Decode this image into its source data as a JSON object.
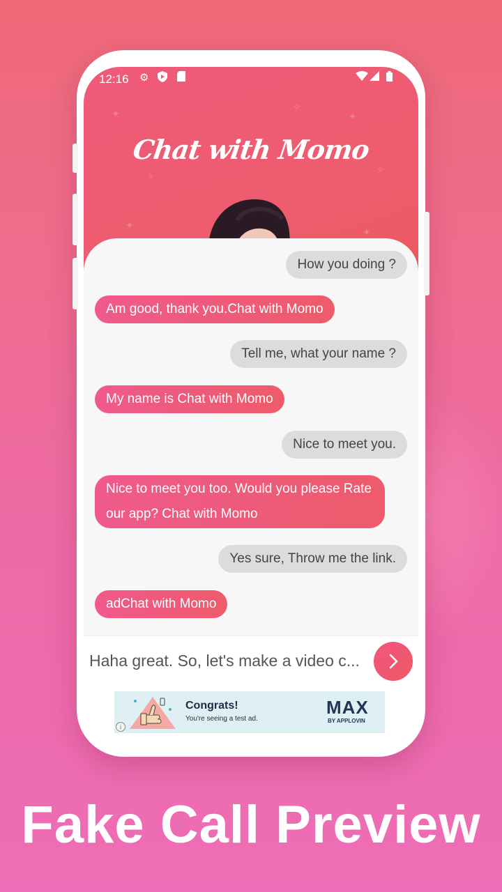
{
  "status_bar": {
    "time": "12:16"
  },
  "app": {
    "title": "Chat with Momo"
  },
  "messages": [
    {
      "side": "out",
      "text": "How you doing ?"
    },
    {
      "side": "in",
      "text": "Am good, thank you.Chat with Momo"
    },
    {
      "side": "out",
      "text": "Tell me, what your name ?"
    },
    {
      "side": "in",
      "text": "My name is Chat with Momo"
    },
    {
      "side": "out",
      "text": "Nice to meet you."
    },
    {
      "side": "in",
      "text": "Nice to meet you too. Would you please Rate our app? Chat with Momo"
    },
    {
      "side": "out",
      "text": "Yes sure, Throw me the link."
    },
    {
      "side": "in",
      "text": "adChat with Momo"
    }
  ],
  "input": {
    "value": "Haha great. So, let's make a video c..."
  },
  "ad": {
    "headline": "Congrats!",
    "subtext": "You're seeing a test ad.",
    "brand": "MAX",
    "brand_sub": "BY APPLOVIN",
    "info": "i"
  },
  "caption": "Fake Call Preview",
  "colors": {
    "accent": "#ee5a74",
    "background": "#ee6aa6",
    "bubble_out": "#dcdcdc"
  }
}
